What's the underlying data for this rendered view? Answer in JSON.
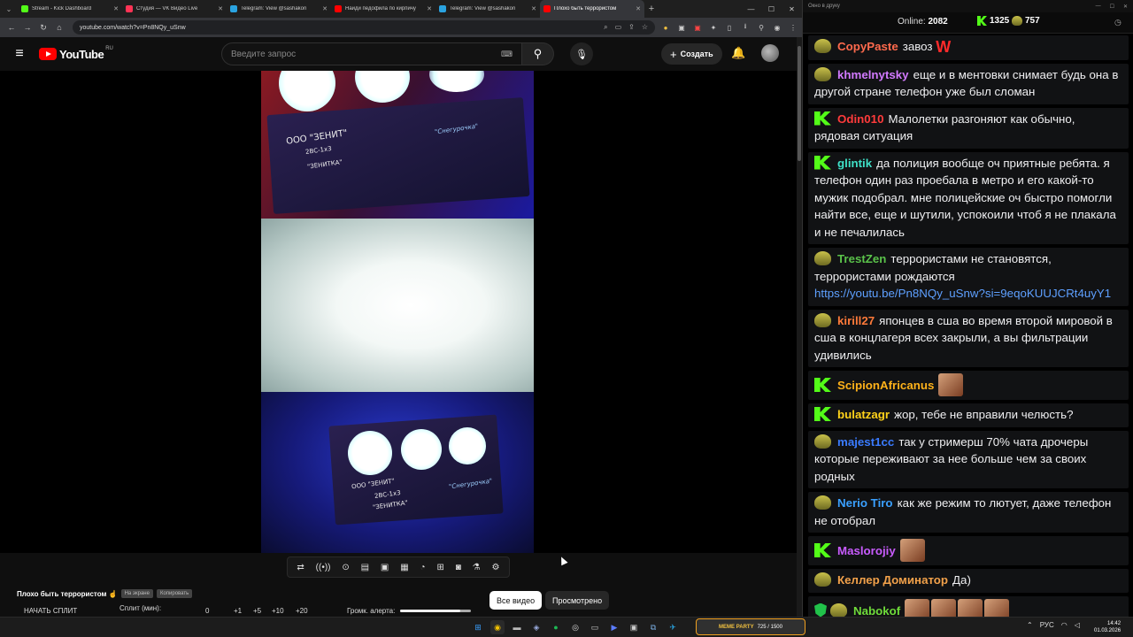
{
  "browser": {
    "tabs": [
      {
        "title": "Stream - Kick Dashboard",
        "color": "#53fc18"
      },
      {
        "title": "Студия — VK Видео Live",
        "color": "#ff3355"
      },
      {
        "title": "Telegram: View @sashakon",
        "color": "#2aa3e0"
      },
      {
        "title": "Найди педофила по кирпичу",
        "color": "#ff0000"
      },
      {
        "title": "Telegram: View @sashakon",
        "color": "#2aa3e0"
      },
      {
        "title": "Плохо быть террористом",
        "color": "#ff0000"
      }
    ],
    "url": "youtube.com/watch?v=Pn8NQy_uSnw"
  },
  "youtube": {
    "logo_text": "YouTube",
    "region": "RU",
    "search_placeholder": "Введите запрос",
    "create_label": "Создать"
  },
  "video": {
    "labels": {
      "maker1": "ООО \"ЗЕНИТ\"",
      "model1": "2ВС-1х3",
      "name1": "\"ЗЕНИТКА\"",
      "script1": "\"Снегурочка\"",
      "maker2": "ООО \"ЗЕНИТ\"",
      "model2": "2ВС-1х3",
      "name2": "\"ЗЕНИТКА\"",
      "script2": "\"Снегурочка\""
    }
  },
  "stream_bar": {
    "title": "Плохо быть террористом ☝",
    "pill1": "На экране",
    "pill2": "Копировать",
    "tab_all": "Все видео",
    "tab_watched": "Просмотрено",
    "start_split": "НАЧАТЬ СПЛИТ",
    "split_label": "Сплит (мин):",
    "split_value": "0",
    "steps": [
      "+1",
      "+5",
      "+10",
      "+20"
    ],
    "volume_label": "Громк. алерта:",
    "volume_level": 0.85
  },
  "chat": {
    "window_title": "Окно в друку",
    "online_label": "Online:",
    "online_count": "2082",
    "kick_count": "1325",
    "other_count": "757",
    "messages": [
      {
        "user": "CopyPaste",
        "color": "#ff6a4d",
        "badge": "pepe",
        "text": "завоз",
        "emote": "W"
      },
      {
        "user": "khmelnytsky",
        "color": "#d27aff",
        "badge": "pepe",
        "text": "еще и в ментовки снимает будь она в другой стране телефон уже был сломан"
      },
      {
        "user": "Odin010",
        "color": "#ff3b3b",
        "badge": "kick",
        "text": "Малолетки разгоняют как обычно, рядовая ситуация"
      },
      {
        "user": "glintik",
        "color": "#3fe0c7",
        "badge": "kick",
        "text": "да полиция вообще оч приятные ребята. я телефон один раз проебала в метро и его какой-то мужик подобрал. мне полицейские оч быстро помогли найти все, еще и шутили, успокоили чтоб я не плакала и не печалилась"
      },
      {
        "user": "TrestZen",
        "color": "#5ac24a",
        "badge": "pepe",
        "text": "террористами не становятся, террористами рождаются",
        "link": "https://youtu.be/Pn8NQy_uSnw?si=9eqoKUUJCRt4uyY1"
      },
      {
        "user": "kirill27",
        "color": "#ff7a3a",
        "badge": "pepe",
        "text": "японцев в сша во время второй мировой в сша в концлагеря всех закрыли, а вы фильтрации удивились"
      },
      {
        "user": "ScipionAfricanus",
        "color": "#ffb21a",
        "badge": "kick",
        "text": "",
        "emotes": 1
      },
      {
        "user": "bulatzagr",
        "color": "#ffd21a",
        "badge": "kick",
        "text": "жор, тебе не вправили челюсть?"
      },
      {
        "user": "majest1cc",
        "color": "#3a7bff",
        "badge": "pepe",
        "text": "так у стримерш 70% чата дрочеры которые переживают за нее больше чем за своих родных"
      },
      {
        "user": "Nerio Tiro",
        "color": "#3aa0ff",
        "badge": "pepe",
        "text": "как же режим то лютует, даже телефон не отобрал"
      },
      {
        "user": "Maslorojiy",
        "color": "#c95cff",
        "badge": "kick",
        "text": "",
        "emotes": 1
      },
      {
        "user": "Келлер Доминатор",
        "color": "#f2a14a",
        "badge": "pepe",
        "text": "Да)"
      },
      {
        "user": "Nabokof",
        "color": "#6fdc3a",
        "badge": "shield",
        "text": "",
        "emotes": 4
      }
    ]
  },
  "taskbar": {
    "widget_tag": "MEME PARTY",
    "widget_value": "725 / 1500",
    "lang": "РУС",
    "time": "14:42",
    "date": "01.03.2026"
  }
}
